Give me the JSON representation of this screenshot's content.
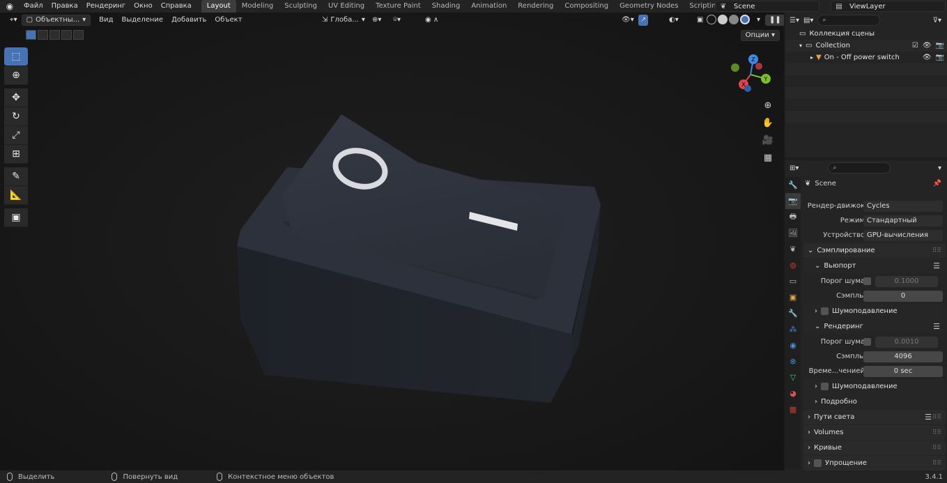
{
  "top_menu": [
    "Файл",
    "Правка",
    "Рендеринг",
    "Окно",
    "Справка"
  ],
  "workspaces": [
    "Layout",
    "Modeling",
    "Sculpting",
    "UV Editing",
    "Texture Paint",
    "Shading",
    "Animation",
    "Rendering",
    "Compositing",
    "Geometry Nodes",
    "Scripting"
  ],
  "active_workspace": "Layout",
  "add_workspace": "+",
  "scene_name": "Scene",
  "view_layer": "ViewLayer",
  "viewport": {
    "mode": "Объектны...",
    "menus": [
      "Вид",
      "Выделение",
      "Добавить",
      "Объект"
    ],
    "orientation": "Глоба...",
    "options": "Опции",
    "switch_symbol_off": "O",
    "switch_symbol_on": "I"
  },
  "gizmo_axes": {
    "x": "X",
    "y": "Y",
    "z": "Z"
  },
  "outliner": {
    "root": "Коллекция сцены",
    "collection": "Collection",
    "object": "On - Off power switch"
  },
  "properties": {
    "context_name": "Scene",
    "render_engine_label": "Рендер-движок",
    "render_engine": "Cycles",
    "mode_label": "Режим",
    "mode": "Стандартный",
    "device_label": "Устройство",
    "device": "GPU-вычисления",
    "sampling_title": "Сэмплирование",
    "viewport_title": "Вьюпорт",
    "noise_threshold_label": "Порог шума",
    "viewport_noise_threshold": "0.1000",
    "samples_label": "Сэмплы",
    "viewport_samples": "0",
    "denoise_label": "Шумоподавление",
    "render_title": "Рендеринг",
    "render_noise_threshold": "0.0010",
    "render_samples": "4096",
    "time_limit_label": "Време...ченией",
    "time_limit": "0 sec",
    "advanced_title": "Подробно",
    "light_paths": "Пути света",
    "volumes": "Volumes",
    "curves": "Кривые",
    "simplify": "Упрощение"
  },
  "status_bar": {
    "select": "Выделить",
    "rotate_view": "Повернуть вид",
    "context_menu": "Контекстное меню объектов",
    "version": "3.4.1"
  },
  "colors": {
    "accent": "#4772b3",
    "axis_x": "#e0424e",
    "axis_y": "#7fbd2c",
    "axis_z": "#3f8ae6"
  }
}
